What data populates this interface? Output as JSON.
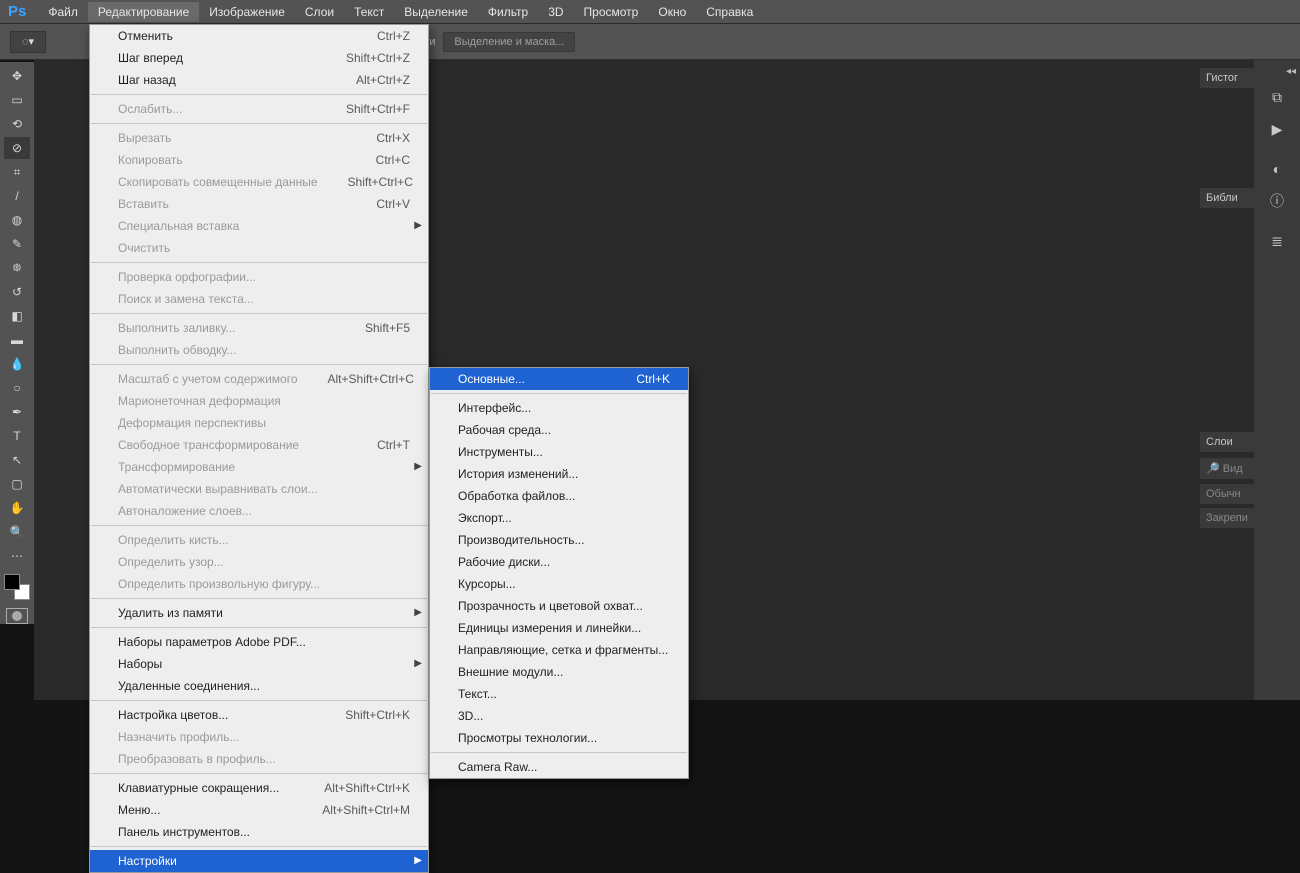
{
  "menubar": {
    "items": [
      "Файл",
      "Редактирование",
      "Изображение",
      "Слои",
      "Текст",
      "Выделение",
      "Фильтр",
      "3D",
      "Просмотр",
      "Окно",
      "Справка"
    ],
    "active_index": 1
  },
  "optionsbar": {
    "truncated_label": "атически",
    "pill": "Выделение и маска..."
  },
  "edit_menu": [
    {
      "label": "Отменить",
      "shortcut": "Ctrl+Z"
    },
    {
      "label": "Шаг вперед",
      "shortcut": "Shift+Ctrl+Z"
    },
    {
      "label": "Шаг назад",
      "shortcut": "Alt+Ctrl+Z"
    },
    {
      "sep": true
    },
    {
      "label": "Ослабить...",
      "shortcut": "Shift+Ctrl+F",
      "disabled": true
    },
    {
      "sep": true
    },
    {
      "label": "Вырезать",
      "shortcut": "Ctrl+X",
      "disabled": true
    },
    {
      "label": "Копировать",
      "shortcut": "Ctrl+C",
      "disabled": true
    },
    {
      "label": "Скопировать совмещенные данные",
      "shortcut": "Shift+Ctrl+C",
      "disabled": true
    },
    {
      "label": "Вставить",
      "shortcut": "Ctrl+V",
      "disabled": true
    },
    {
      "label": "Специальная вставка",
      "submenu": true,
      "disabled": true
    },
    {
      "label": "Очистить",
      "disabled": true
    },
    {
      "sep": true
    },
    {
      "label": "Проверка орфографии...",
      "disabled": true
    },
    {
      "label": "Поиск и замена текста...",
      "disabled": true
    },
    {
      "sep": true
    },
    {
      "label": "Выполнить заливку...",
      "shortcut": "Shift+F5",
      "disabled": true
    },
    {
      "label": "Выполнить обводку...",
      "disabled": true
    },
    {
      "sep": true
    },
    {
      "label": "Масштаб с учетом содержимого",
      "shortcut": "Alt+Shift+Ctrl+C",
      "disabled": true
    },
    {
      "label": "Марионеточная деформация",
      "disabled": true
    },
    {
      "label": "Деформация перспективы",
      "disabled": true
    },
    {
      "label": "Свободное трансформирование",
      "shortcut": "Ctrl+T",
      "disabled": true
    },
    {
      "label": "Трансформирование",
      "submenu": true,
      "disabled": true
    },
    {
      "label": "Автоматически выравнивать слои...",
      "disabled": true
    },
    {
      "label": "Автоналожение слоев...",
      "disabled": true
    },
    {
      "sep": true
    },
    {
      "label": "Определить кисть...",
      "disabled": true
    },
    {
      "label": "Определить узор...",
      "disabled": true
    },
    {
      "label": "Определить произвольную фигуру...",
      "disabled": true
    },
    {
      "sep": true
    },
    {
      "label": "Удалить из памяти",
      "submenu": true
    },
    {
      "sep": true
    },
    {
      "label": "Наборы параметров Adobe PDF..."
    },
    {
      "label": "Наборы",
      "submenu": true
    },
    {
      "label": "Удаленные соединения..."
    },
    {
      "sep": true
    },
    {
      "label": "Настройка цветов...",
      "shortcut": "Shift+Ctrl+K"
    },
    {
      "label": "Назначить профиль...",
      "disabled": true
    },
    {
      "label": "Преобразовать в профиль...",
      "disabled": true
    },
    {
      "sep": true
    },
    {
      "label": "Клавиатурные сокращения...",
      "shortcut": "Alt+Shift+Ctrl+K"
    },
    {
      "label": "Меню...",
      "shortcut": "Alt+Shift+Ctrl+M"
    },
    {
      "label": "Панель инструментов..."
    },
    {
      "sep": true
    },
    {
      "label": "Настройки",
      "submenu": true,
      "highlight": true
    }
  ],
  "prefs_menu": [
    {
      "label": "Основные...",
      "shortcut": "Ctrl+K",
      "highlight": true
    },
    {
      "sep": true
    },
    {
      "label": "Интерфейс..."
    },
    {
      "label": "Рабочая среда..."
    },
    {
      "label": "Инструменты..."
    },
    {
      "label": "История изменений..."
    },
    {
      "label": "Обработка файлов..."
    },
    {
      "label": "Экспорт..."
    },
    {
      "label": "Производительность..."
    },
    {
      "label": "Рабочие диски..."
    },
    {
      "label": "Курсоры..."
    },
    {
      "label": "Прозрачность и цветовой охват..."
    },
    {
      "label": "Единицы измерения и линейки..."
    },
    {
      "label": "Направляющие, сетка и фрагменты..."
    },
    {
      "label": "Внешние модули..."
    },
    {
      "label": "Текст..."
    },
    {
      "label": "3D..."
    },
    {
      "label": "Просмотры технологии..."
    },
    {
      "sep": true
    },
    {
      "label": "Camera Raw..."
    }
  ],
  "tools": [
    "move",
    "marquee",
    "lasso",
    "magic-wand",
    "crop",
    "eyedropper",
    "spot-heal",
    "brush",
    "clone",
    "history-brush",
    "eraser",
    "gradient",
    "blur",
    "dodge",
    "pen",
    "type",
    "path-select",
    "rectangle",
    "hand",
    "zoom",
    "more"
  ],
  "right_tabs": {
    "histogram": "Гистог",
    "libraries": "Библи",
    "layers": "Слои",
    "search_placeholder": "Вид",
    "normal": "Обычн",
    "lock": "Закрепи"
  }
}
